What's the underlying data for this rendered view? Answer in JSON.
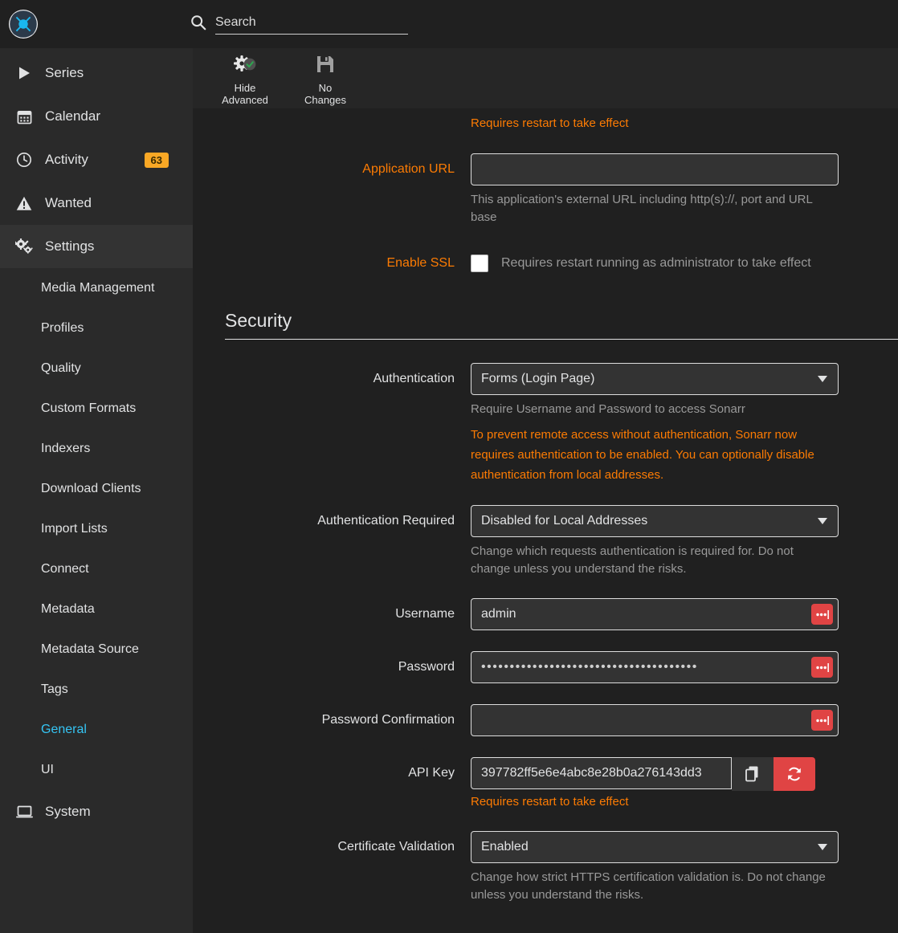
{
  "app": {
    "logo_name": "sonarr-logo"
  },
  "search": {
    "placeholder": "Search",
    "value": ""
  },
  "sidebar": {
    "items": [
      {
        "label": "Series",
        "icon": "play-icon",
        "badge": null,
        "active": false
      },
      {
        "label": "Calendar",
        "icon": "calendar-icon",
        "badge": null,
        "active": false
      },
      {
        "label": "Activity",
        "icon": "clock-icon",
        "badge": "63",
        "active": false
      },
      {
        "label": "Wanted",
        "icon": "warning-icon",
        "badge": null,
        "active": false
      },
      {
        "label": "Settings",
        "icon": "gears-icon",
        "badge": null,
        "active": true
      },
      {
        "label": "System",
        "icon": "laptop-icon",
        "badge": null,
        "active": false
      }
    ],
    "settings_subitems": [
      {
        "label": "Media Management",
        "selected": false
      },
      {
        "label": "Profiles",
        "selected": false
      },
      {
        "label": "Quality",
        "selected": false
      },
      {
        "label": "Custom Formats",
        "selected": false
      },
      {
        "label": "Indexers",
        "selected": false
      },
      {
        "label": "Download Clients",
        "selected": false
      },
      {
        "label": "Import Lists",
        "selected": false
      },
      {
        "label": "Connect",
        "selected": false
      },
      {
        "label": "Metadata",
        "selected": false
      },
      {
        "label": "Metadata Source",
        "selected": false
      },
      {
        "label": "Tags",
        "selected": false
      },
      {
        "label": "General",
        "selected": true
      },
      {
        "label": "UI",
        "selected": false
      }
    ]
  },
  "toolbar": {
    "buttons": [
      {
        "label_line1": "Hide",
        "label_line2": "Advanced",
        "icon": "advanced-settings-icon"
      },
      {
        "label_line1": "No",
        "label_line2": "Changes",
        "icon": "save-disk-icon"
      }
    ]
  },
  "form": {
    "top_warning": "Requires restart to take effect",
    "application_url": {
      "label": "Application URL",
      "value": "",
      "help": "This application's external URL including http(s)://, port and URL base",
      "advanced": true
    },
    "enable_ssl": {
      "label": "Enable SSL",
      "checked": false,
      "checkbox_text": "Requires restart running as administrator to take effect",
      "advanced": true
    },
    "security_section": {
      "title": "Security"
    },
    "authentication": {
      "label": "Authentication",
      "value": "Forms (Login Page)",
      "help": "Require Username and Password to access Sonarr",
      "warning": "To prevent remote access without authentication, Sonarr now requires authentication to be enabled. You can optionally disable authentication from local addresses."
    },
    "authentication_required": {
      "label": "Authentication Required",
      "value": "Disabled for Local Addresses",
      "help": "Change which requests authentication is required for. Do not change unless you understand the risks."
    },
    "username": {
      "label": "Username",
      "value": "admin"
    },
    "password": {
      "label": "Password",
      "value": "••••••••••••••••••••••••••••••••••••••"
    },
    "password_confirmation": {
      "label": "Password Confirmation",
      "value": ""
    },
    "api_key": {
      "label": "API Key",
      "value": "397782ff5e6e4abc8e28b0a276143dd3",
      "warning": "Requires restart to take effect",
      "copy_icon": "copy-icon",
      "regenerate_icon": "refresh-icon"
    },
    "certificate_validation": {
      "label": "Certificate Validation",
      "value": "Enabled",
      "help": "Change how strict HTTPS certification validation is. Do not change unless you understand the risks."
    }
  },
  "colors": {
    "accent_orange": "#fc7b03",
    "accent_blue": "#35c5f4",
    "danger_red": "#e04444",
    "badge_orange": "#f9a825",
    "sidebar_bg": "#2a2a2a",
    "main_bg": "#202020"
  }
}
